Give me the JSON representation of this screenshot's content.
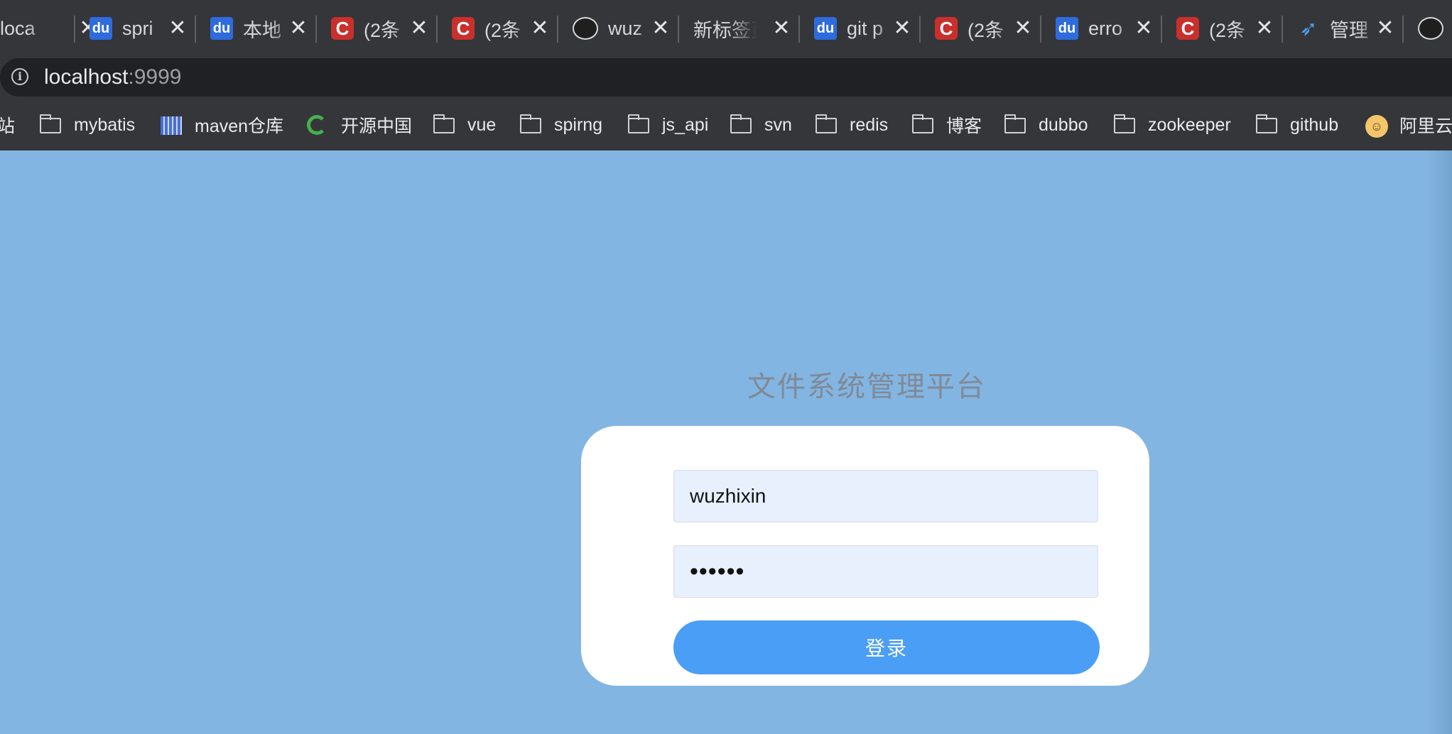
{
  "tabs": [
    {
      "title": "loca",
      "favicon": "none"
    },
    {
      "title": "spri",
      "favicon": "baidu-icon"
    },
    {
      "title": "本地",
      "favicon": "baidu-icon"
    },
    {
      "title": "(2条",
      "favicon": "csdn-icon"
    },
    {
      "title": "(2条",
      "favicon": "csdn-icon"
    },
    {
      "title": "wuz",
      "favicon": "github-icon"
    },
    {
      "title": "新标签页",
      "favicon": "none"
    },
    {
      "title": "git p",
      "favicon": "baidu-icon"
    },
    {
      "title": "(2条",
      "favicon": "csdn-icon"
    },
    {
      "title": "erro",
      "favicon": "baidu-icon"
    },
    {
      "title": "(2条",
      "favicon": "csdn-icon"
    },
    {
      "title": "管理",
      "favicon": "rocket-icon"
    }
  ],
  "tab_close_glyph": "✕",
  "address_bar": {
    "host": "localhost",
    "port": ":9999"
  },
  "bookmarks": [
    {
      "label": "站",
      "icon": "none"
    },
    {
      "label": "mybatis",
      "icon": "folder-icon"
    },
    {
      "label": "maven仓库",
      "icon": "maven-icon"
    },
    {
      "label": "开源中国",
      "icon": "oschina-icon"
    },
    {
      "label": "vue",
      "icon": "folder-icon"
    },
    {
      "label": "spirng",
      "icon": "folder-icon"
    },
    {
      "label": "js_api",
      "icon": "folder-icon"
    },
    {
      "label": "svn",
      "icon": "folder-icon"
    },
    {
      "label": "redis",
      "icon": "folder-icon"
    },
    {
      "label": "博客",
      "icon": "folder-icon"
    },
    {
      "label": "dubbo",
      "icon": "folder-icon"
    },
    {
      "label": "zookeeper",
      "icon": "folder-icon"
    },
    {
      "label": "github",
      "icon": "folder-icon"
    },
    {
      "label": "阿里云",
      "icon": "aliyun-icon"
    }
  ],
  "login": {
    "title": "文件系统管理平台",
    "username_value": "wuzhixin",
    "password_masked": "••••••",
    "submit_label": "登录"
  },
  "colors": {
    "page_background": "#83b5e2",
    "button": "#4a9ef6",
    "input_background": "#e8f0fe",
    "browser_chrome": "#35363a"
  }
}
